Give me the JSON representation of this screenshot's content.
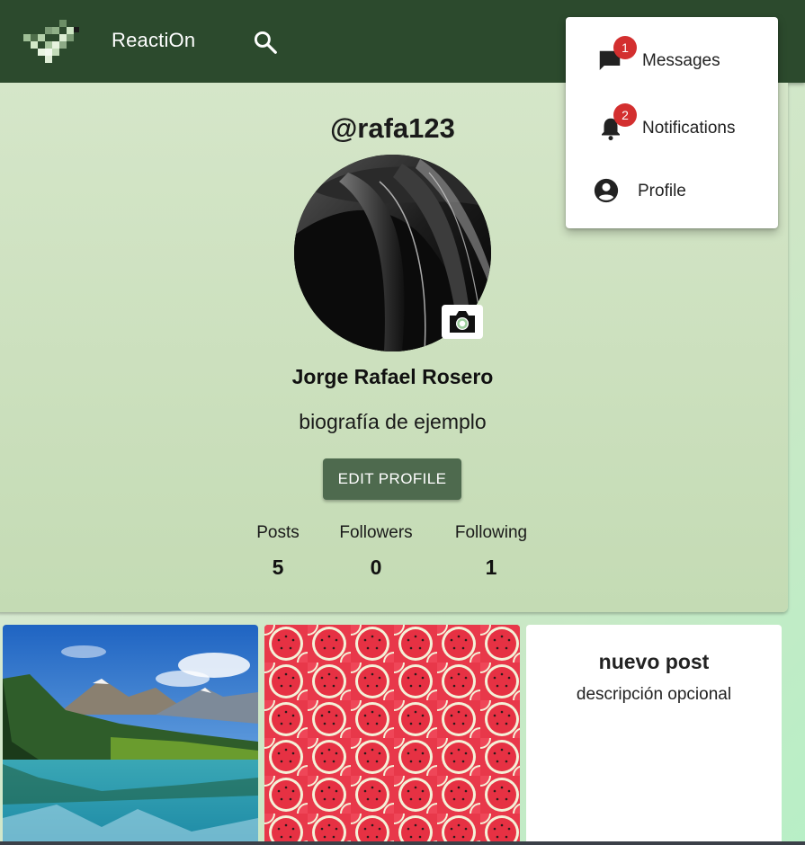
{
  "appbar": {
    "title": "ReactiOn",
    "logo_icon": "pixel-logo-icon",
    "search_icon": "search-icon",
    "background": "#2c4a2d"
  },
  "profile": {
    "username": "@rafa123",
    "full_name": "Jorge Rafael Rosero",
    "bio": "biografía de ejemplo",
    "edit_button": "EDIT PROFILE",
    "camera_icon": "camera-icon",
    "stats": {
      "posts_label": "Posts",
      "posts_value": "5",
      "followers_label": "Followers",
      "followers_value": "0",
      "following_label": "Following",
      "following_value": "1"
    }
  },
  "posts": [
    {
      "type": "image",
      "image": "mountain-lake-photo"
    },
    {
      "type": "image",
      "image": "watermelon-pattern-photo"
    },
    {
      "type": "text",
      "title": "nuevo post",
      "description": "descripción opcional"
    }
  ],
  "menu": {
    "items": [
      {
        "label": "Messages",
        "icon": "chat-icon",
        "badge": "1"
      },
      {
        "label": "Notifications",
        "icon": "bell-icon",
        "badge": "2"
      },
      {
        "label": "Profile",
        "icon": "account-circle-icon"
      }
    ]
  },
  "colors": {
    "accent": "#4e6a4e",
    "badge": "#d32f2f",
    "card": "#cfe3c2"
  }
}
